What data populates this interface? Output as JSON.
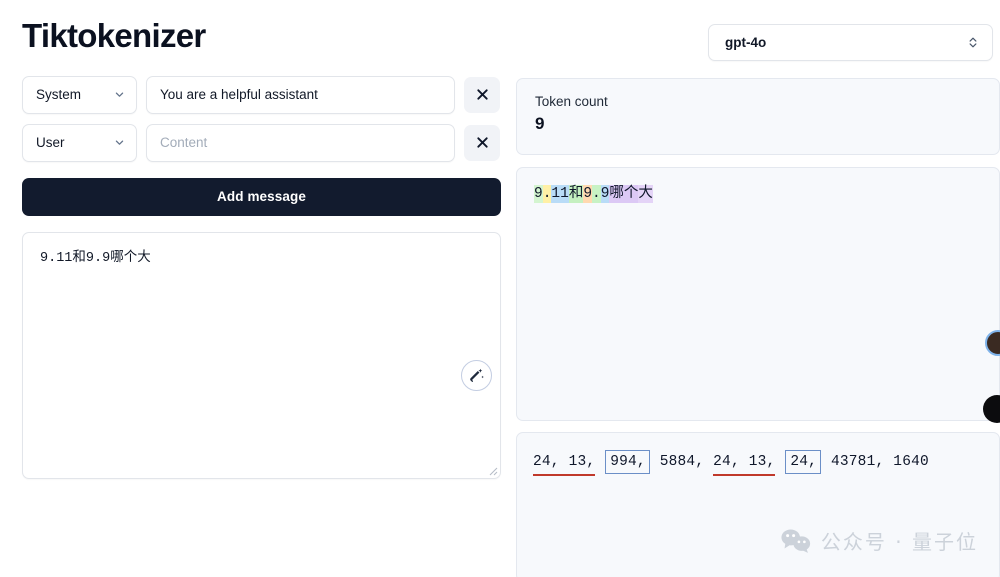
{
  "app": {
    "title": "Tiktokenizer"
  },
  "model_selector": {
    "value": "gpt-4o",
    "icon": "chevron-updown-icon"
  },
  "messages": [
    {
      "role": "System",
      "role_icon": "chevron-down-icon",
      "content": "You are a helpful assistant",
      "placeholder": "Content",
      "remove_icon": "close-icon"
    },
    {
      "role": "User",
      "role_icon": "chevron-down-icon",
      "content": "",
      "placeholder": "Content",
      "remove_icon": "close-icon"
    }
  ],
  "add_message_label": "Add message",
  "input_area": {
    "value": "9.11和9.9哪个大",
    "magic_icon": "magic-wand-icon",
    "resize_icon": "resize-grip-icon"
  },
  "token_count": {
    "label": "Token count",
    "value": "9"
  },
  "tokens": [
    {
      "text": "9",
      "color": "#d4f5d0"
    },
    {
      "text": ".",
      "color": "#fff0a6"
    },
    {
      "text": "11",
      "color": "#b9dcf7"
    },
    {
      "text": "和",
      "color": "#c5f0c0"
    },
    {
      "text": "9",
      "color": "#ffd9b0"
    },
    {
      "text": ".",
      "color": "#c8f2c4"
    },
    {
      "text": "9",
      "color": "#b9dcf7"
    },
    {
      "text": "哪个",
      "color": "#dcc9f5"
    },
    {
      "text": "大",
      "color": "#e4d4f7"
    }
  ],
  "token_ids": {
    "groups": [
      {
        "text": "24, 13,",
        "style": "underline-red"
      },
      {
        "text": " ",
        "style": "plain"
      },
      {
        "text": "994,",
        "style": "box-blue"
      },
      {
        "text": " 5884, ",
        "style": "plain"
      },
      {
        "text": "24, 13,",
        "style": "underline-red"
      },
      {
        "text": " ",
        "style": "plain"
      },
      {
        "text": "24,",
        "style": "box-blue"
      },
      {
        "text": " 43781, 1640",
        "style": "plain"
      }
    ],
    "ids": [
      24,
      13,
      994,
      5884,
      24,
      13,
      24,
      43781,
      1640
    ]
  },
  "watermark": {
    "icon": "wechat-icon",
    "text": "公众号 · 量子位"
  },
  "colors": {
    "accent_dark": "#121b2e",
    "panel_bg": "#f7f9fc",
    "border": "#e2e5ea",
    "annotation_red": "#c0392b",
    "annotation_blue": "#6b8fc7"
  }
}
